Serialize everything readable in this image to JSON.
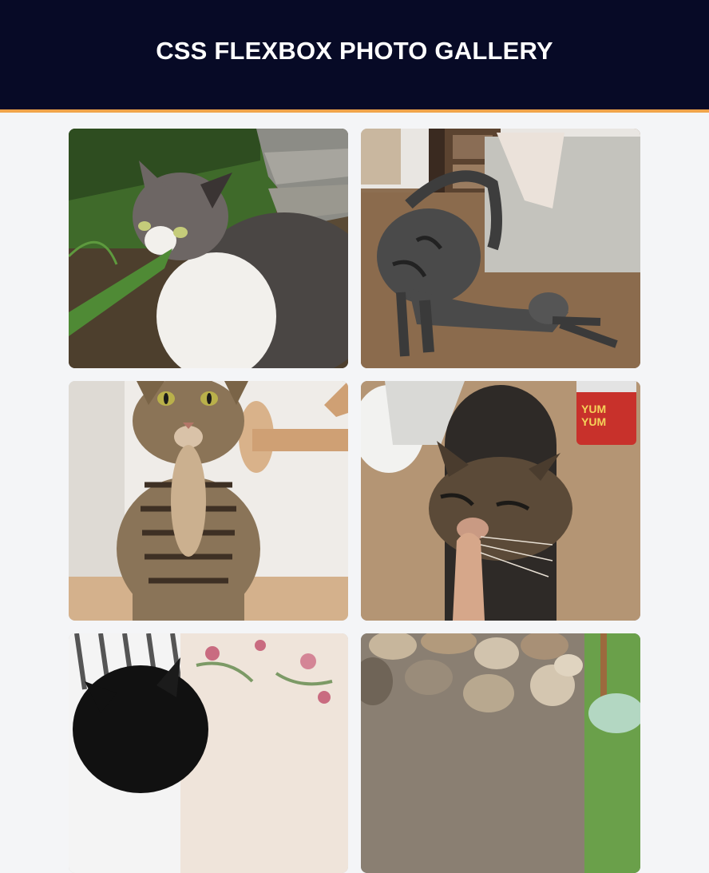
{
  "header": {
    "title": "CSS FLEXBOX PHOTO GALLERY"
  },
  "gallery": {
    "photos": [
      {
        "icon": "cat-in-garden-photo"
      },
      {
        "icon": "stretching-tabby-cat-photo"
      },
      {
        "icon": "sitting-tabby-cat-photo"
      },
      {
        "icon": "cat-sniffing-finger-photo"
      },
      {
        "icon": "black-cat-on-blanket-photo"
      },
      {
        "icon": "rocky-wall-photo"
      }
    ]
  },
  "colors": {
    "header_bg": "#070a26",
    "header_border": "#f0a44a",
    "page_bg": "#f4f5f7"
  }
}
